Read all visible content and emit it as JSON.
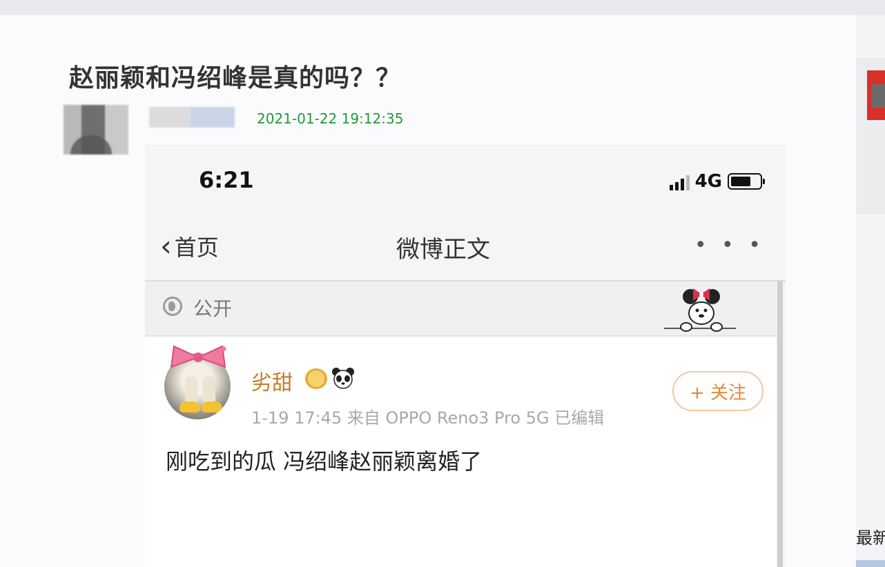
{
  "article": {
    "title": "赵丽颖和冯绍峰是真的吗？？",
    "timestamp": "2021-01-22 19:12:35"
  },
  "phone": {
    "status_time": "6:21",
    "network": "4G",
    "nav_back": "首页",
    "nav_title": "微博正文",
    "more": "• • •",
    "visibility": "公开",
    "user_name": "劣甜",
    "post_meta": "1-19 17:45  来自 OPPO Reno3 Pro 5G  已编辑",
    "follow_label": "+ 关注",
    "post_body": "刚吃到的瓜 冯绍峰赵丽颖离婚了"
  },
  "sidebar": {
    "text": "最新"
  },
  "colors": {
    "timestamp": "#1f9a3a",
    "username": "#c87a2a",
    "follow": "#e08a3c"
  }
}
